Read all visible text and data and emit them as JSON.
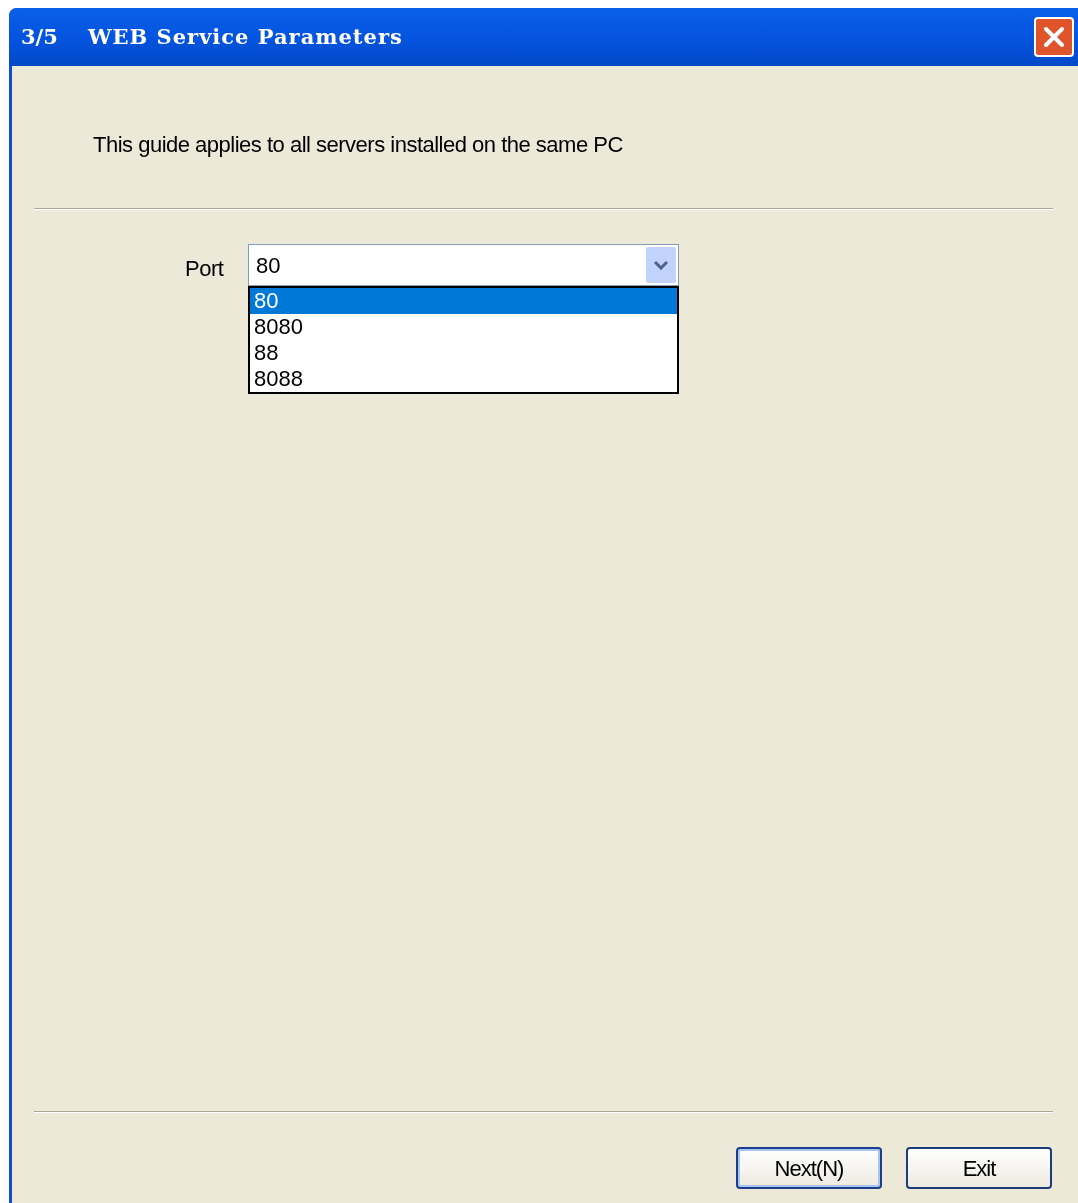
{
  "window": {
    "step": "3/5",
    "title": "WEB Service Parameters"
  },
  "intro": "This guide applies to all servers installed on the same PC",
  "port": {
    "label": "Port",
    "value": "80",
    "expanded": true,
    "options": [
      {
        "label": "80",
        "selected": true
      },
      {
        "label": "8080",
        "selected": false
      },
      {
        "label": "88",
        "selected": false
      },
      {
        "label": "8088",
        "selected": false
      }
    ]
  },
  "buttons": [
    {
      "label": "Next(N)",
      "default": true
    },
    {
      "label": "Exit",
      "default": false
    }
  ]
}
